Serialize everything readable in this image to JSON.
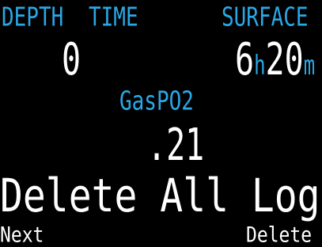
{
  "colors": {
    "background": "#000000",
    "label": "#2aa8e6",
    "value": "#ffffff"
  },
  "header": {
    "depth_label": "DEPTH",
    "time_label": "TIME",
    "surface_label": "SURFACE"
  },
  "readings": {
    "depth_value": "0",
    "surface_hours": "6",
    "surface_hours_unit": "h",
    "surface_minutes": "20",
    "surface_minutes_unit": "m"
  },
  "gas": {
    "label": "GasPO2",
    "value": ".21"
  },
  "menu": {
    "title": "Delete All Logs"
  },
  "softkeys": {
    "left_label": "Next",
    "right_label": "Delete"
  }
}
